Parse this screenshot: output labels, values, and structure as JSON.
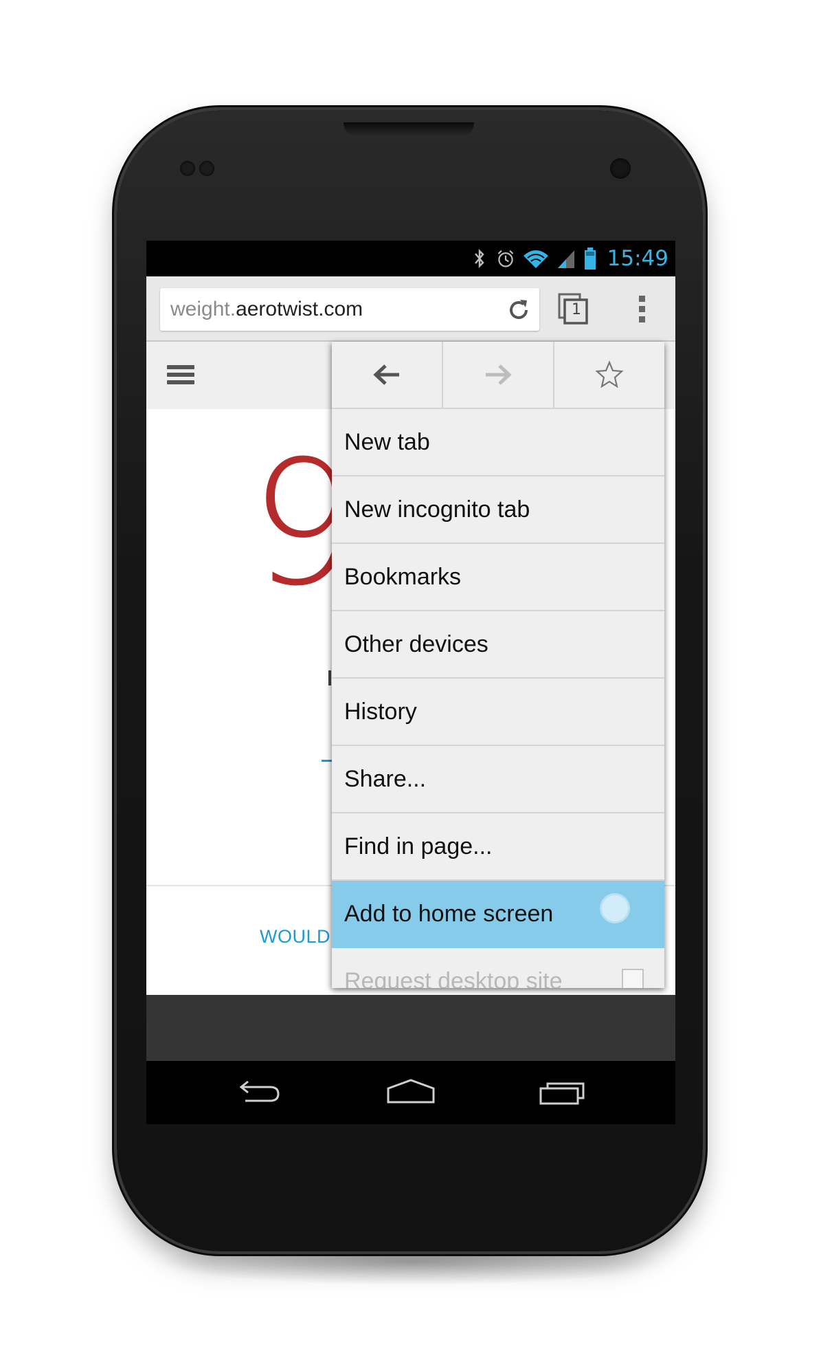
{
  "status_bar": {
    "time": "15:49",
    "icons": [
      "bluetooth-icon",
      "alarm-icon",
      "wifi-icon",
      "signal-icon",
      "battery-icon"
    ],
    "accent_color": "#33b5e5"
  },
  "toolbar": {
    "url_prefix": "weight.",
    "url_domain": "aerotwist.com",
    "tab_count": "1"
  },
  "page": {
    "big_digit": "9",
    "teaser": "WOULD",
    "digit_color": "#b21f1f",
    "teaser_color": "#1a9bd6"
  },
  "menu": {
    "nav_icons": [
      "back-arrow-icon",
      "forward-arrow-icon",
      "star-icon"
    ],
    "items": [
      {
        "label": "New tab"
      },
      {
        "label": "New incognito tab"
      },
      {
        "label": "Bookmarks"
      },
      {
        "label": "Other devices"
      },
      {
        "label": "History"
      },
      {
        "label": "Share..."
      },
      {
        "label": "Find in page..."
      },
      {
        "label": "Add to home screen",
        "highlighted": true
      },
      {
        "label": "Request desktop site",
        "checked": false
      }
    ],
    "highlight_color": "#86ccea"
  }
}
